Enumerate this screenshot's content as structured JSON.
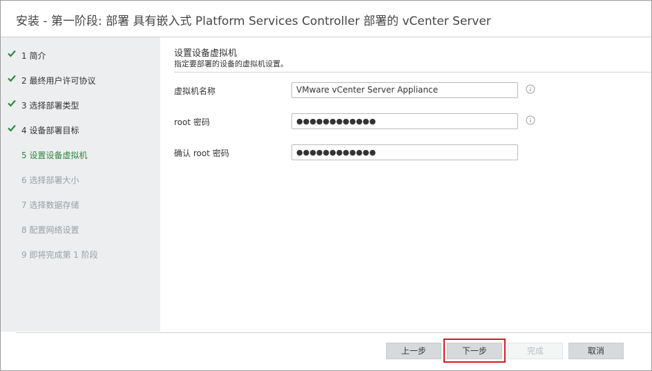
{
  "window": {
    "title": "安装 - 第一阶段: 部署 具有嵌入式 Platform Services Controller 部署的 vCenter Server"
  },
  "sidebar": {
    "steps": [
      {
        "label": "1 简介",
        "state": "completed"
      },
      {
        "label": "2 最终用户许可协议",
        "state": "completed"
      },
      {
        "label": "3 选择部署类型",
        "state": "completed"
      },
      {
        "label": "4 设备部署目标",
        "state": "completed"
      },
      {
        "label": "5 设置设备虚拟机",
        "state": "current"
      },
      {
        "label": "6 选择部署大小",
        "state": "disabled"
      },
      {
        "label": "7 选择数据存储",
        "state": "disabled"
      },
      {
        "label": "8 配置网络设置",
        "state": "disabled"
      },
      {
        "label": "9 即将完成第 1 阶段",
        "state": "disabled"
      }
    ]
  },
  "main": {
    "title": "设置设备虚拟机",
    "subtitle": "指定要部署的设备的虚拟机设置。",
    "fields": [
      {
        "label": "虚拟机名称",
        "value": "VMware vCenter Server Appliance"
      },
      {
        "label": "root 密码",
        "value": "●●●●●●●●●●●●"
      },
      {
        "label": "确认 root 密码",
        "value": "●●●●●●●●●●●●"
      }
    ]
  },
  "buttons": {
    "back": "上一步",
    "next": "下一步",
    "finish": "完成",
    "cancel": "取消"
  },
  "colors": {
    "completed_check": "#2e8540",
    "current_step": "#2e8540",
    "highlight": "#d8181e"
  },
  "icons": {
    "completed": "checkmark-icon",
    "field_info": "info-icon"
  }
}
